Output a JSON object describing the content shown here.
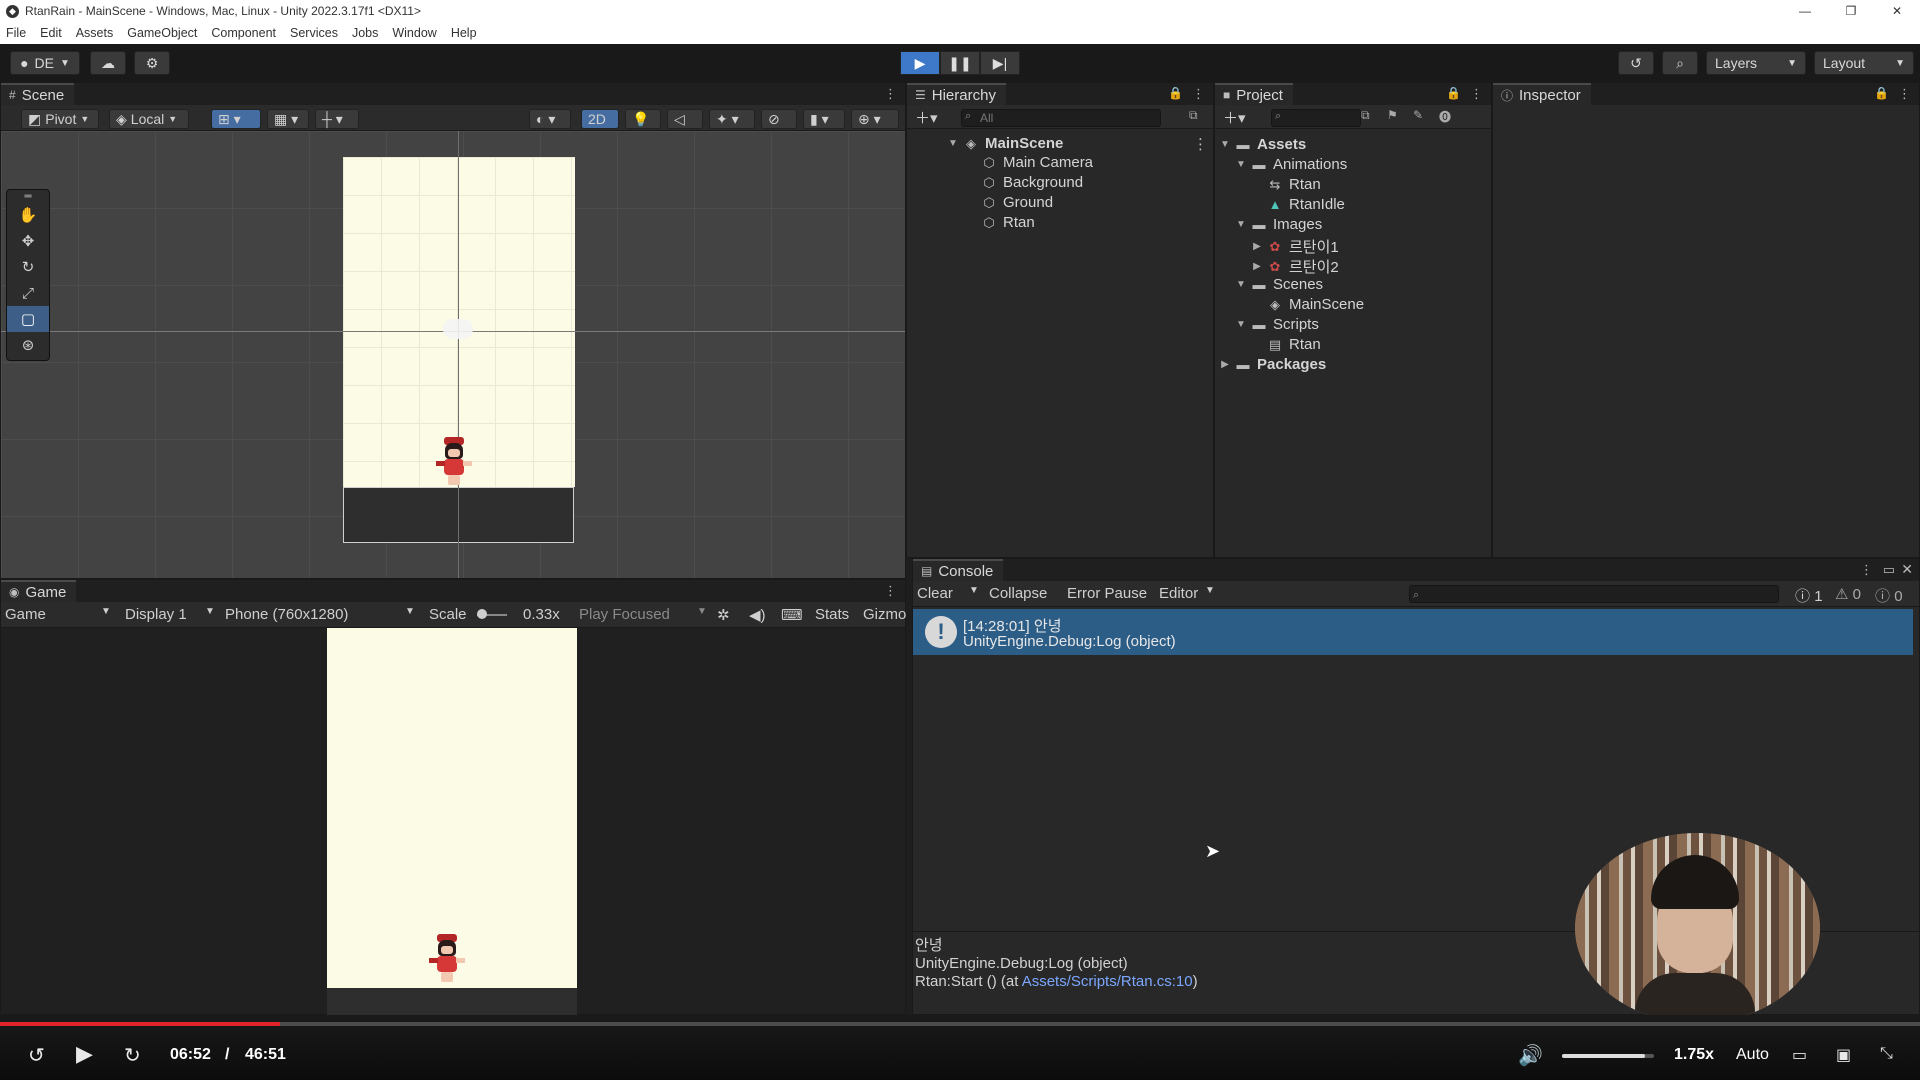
{
  "window": {
    "title": "RtanRain - MainScene - Windows, Mac, Linux - Unity 2022.3.17f1 <DX11>",
    "controls": [
      "—",
      "❐",
      "✕"
    ]
  },
  "menubar": [
    "File",
    "Edit",
    "Assets",
    "GameObject",
    "Component",
    "Services",
    "Jobs",
    "Window",
    "Help"
  ],
  "toolbar": {
    "account": "DE",
    "layers_label": "Layers",
    "layout_label": "Layout"
  },
  "scene": {
    "tab_label": "Scene",
    "pivot": "Pivot",
    "local": "Local",
    "mode_2d": "2D"
  },
  "game": {
    "tab_label": "Game",
    "view": "Game",
    "display": "Display 1",
    "resolution": "Phone (760x1280)",
    "scale_label": "Scale",
    "scale_value": "0.33x",
    "play_focused": "Play Focused",
    "stats": "Stats",
    "gizmos": "Gizmo"
  },
  "hierarchy": {
    "tab_label": "Hierarchy",
    "search_placeholder": "All",
    "scene": "MainScene",
    "items": [
      "Main Camera",
      "Background",
      "Ground",
      "Rtan"
    ]
  },
  "project": {
    "tab_label": "Project",
    "assets": "Assets",
    "animations": "Animations",
    "anim_items": [
      "Rtan",
      "RtanIdle"
    ],
    "images": "Images",
    "image_items": [
      "르탄이1",
      "르탄이2"
    ],
    "scenes": "Scenes",
    "scene_items": [
      "MainScene"
    ],
    "scripts": "Scripts",
    "script_items": [
      "Rtan"
    ],
    "packages": "Packages"
  },
  "inspector": {
    "tab_label": "Inspector"
  },
  "console": {
    "tab_label": "Console",
    "clear": "Clear",
    "collapse": "Collapse",
    "error_pause": "Error Pause",
    "editor": "Editor",
    "count_log": "1",
    "count_warn": "0",
    "count_err": "0",
    "entry_line1": "[14:28:01] 안녕",
    "entry_line2": "UnityEngine.Debug:Log (object)",
    "detail_line1": "안녕",
    "detail_line2": "UnityEngine.Debug:Log (object)",
    "detail_line3_prefix": "Rtan:Start () (at ",
    "detail_link": "Assets/Scripts/Rtan.cs:10",
    "detail_line3_suffix": ")"
  },
  "player": {
    "current_time": "06:52",
    "separator": "/",
    "duration": "46:51",
    "progress": 0.146,
    "volume": 0.9,
    "speed": "1.75x",
    "quality": "Auto"
  }
}
